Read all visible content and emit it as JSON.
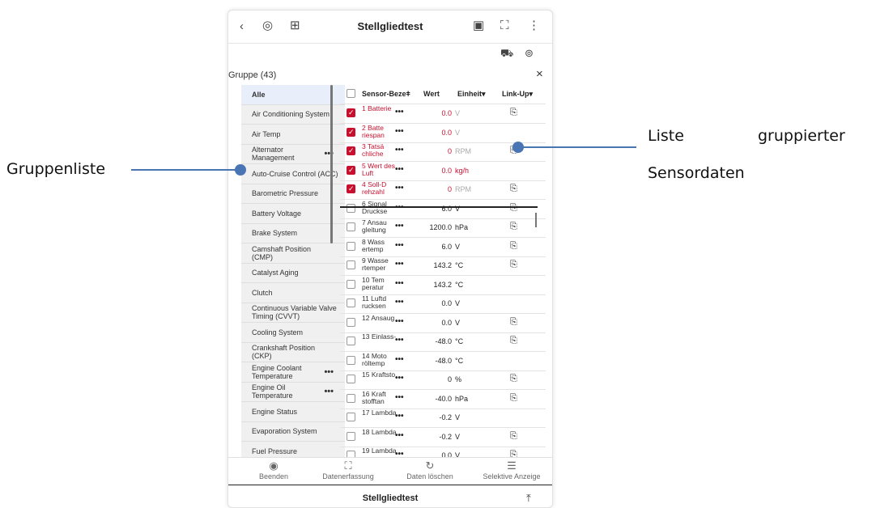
{
  "header": {
    "title": "Stellgliedtest",
    "back_icon": "chevron-left-icon"
  },
  "group": {
    "label": "Gruppe (43)",
    "close": "×"
  },
  "groups": [
    "Alle",
    "Air Conditioning System",
    "Air Temp",
    "Alternator Management",
    "Auto-Cruise Control (ACC)",
    "Barometric Pressure",
    "Battery Voltage",
    "Brake System",
    "Camshaft Position (CMP)",
    "Catalyst Aging",
    "Clutch",
    "Continuous Variable Valve Timing (CVVT)",
    "Cooling System",
    "Crankshaft Position (CKP)",
    "Engine Coolant Temperature",
    "Engine Oil Temperature",
    "Engine Status",
    "Evaporation System",
    "Fuel Pressure"
  ],
  "table": {
    "headers": {
      "name": "Sensor-Bezeǂ",
      "value": "Wert",
      "unit": "Einheit▾",
      "link": "Link-Up▾"
    },
    "rows": [
      {
        "name": "1 Batterie",
        "value": "0.0",
        "unit": "V",
        "checked": true,
        "link": true
      },
      {
        "name": "2 Batte riespan",
        "value": "0.0",
        "unit": "V",
        "checked": true,
        "link": false
      },
      {
        "name": "3 Tatsä chliche",
        "value": "0",
        "unit": "RPM",
        "checked": true,
        "link": true
      },
      {
        "name": "5 Wert des Luft",
        "value": "0.0",
        "unit": "kg/h",
        "checked": true,
        "link": false
      },
      {
        "name": "4 Soll-D rehzahl",
        "value": "0",
        "unit": "RPM",
        "checked": true,
        "link": true
      },
      {
        "name": "6 Signal Druckse",
        "value": "6.0",
        "unit": "V",
        "checked": false,
        "link": true
      },
      {
        "name": "7 Ansau gleitung",
        "value": "1200.0",
        "unit": "hPa",
        "checked": false,
        "link": true
      },
      {
        "name": "8 Wass ertemp",
        "value": "6.0",
        "unit": "V",
        "checked": false,
        "link": true
      },
      {
        "name": "9 Wasse rtemper",
        "value": "143.2",
        "unit": "°C",
        "checked": false,
        "link": true
      },
      {
        "name": "10 Tem peratur",
        "value": "143.2",
        "unit": "°C",
        "checked": false,
        "link": false
      },
      {
        "name": "11 Luftd rucksen",
        "value": "0.0",
        "unit": "V",
        "checked": false,
        "link": false
      },
      {
        "name": "12 Ansaug",
        "value": "0.0",
        "unit": "V",
        "checked": false,
        "link": true
      },
      {
        "name": "13 Einlass-",
        "value": "-48.0",
        "unit": "°C",
        "checked": false,
        "link": true
      },
      {
        "name": "14 Moto röltemp",
        "value": "-48.0",
        "unit": "°C",
        "checked": false,
        "link": false
      },
      {
        "name": "15 Kraftsto",
        "value": "0",
        "unit": "%",
        "checked": false,
        "link": true
      },
      {
        "name": "16 Kraft stofftan",
        "value": "-40.0",
        "unit": "hPa",
        "checked": false,
        "link": true
      },
      {
        "name": "17 Lambda",
        "value": "-0.2",
        "unit": "V",
        "checked": false,
        "link": false
      },
      {
        "name": "18 Lambda",
        "value": "-0.2",
        "unit": "V",
        "checked": false,
        "link": true
      },
      {
        "name": "19 Lambda",
        "value": "0.0",
        "unit": "V",
        "checked": false,
        "link": true
      }
    ]
  },
  "bottom": {
    "exit": "Beenden",
    "capture": "Datenerfassung",
    "clear": "Daten löschen",
    "select": "Selektive Anzeige"
  },
  "footer": {
    "title": "Stellgliedtest"
  },
  "annotations": {
    "left": "Gruppenliste",
    "right_line1": "Liste",
    "right_line1b": "gruppierter",
    "right_line2": "Sensordaten"
  },
  "colors": {
    "accent": "#c8102e",
    "annotation": "#4a75b5"
  }
}
